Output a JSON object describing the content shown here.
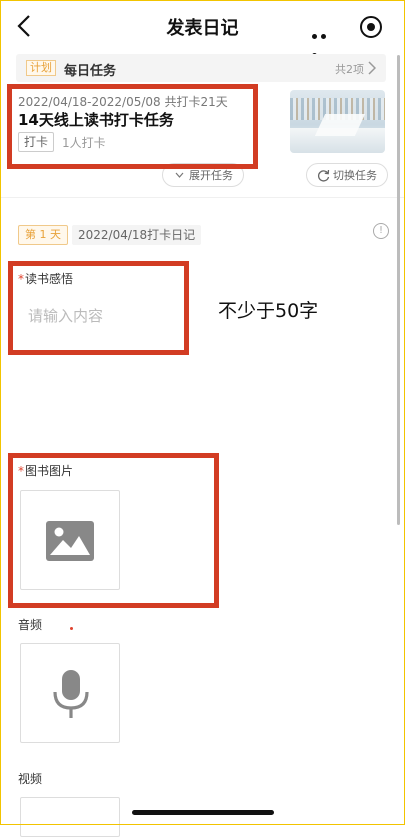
{
  "nav": {
    "title": "发表日记"
  },
  "task_header": {
    "tag": "计划",
    "title": "每日任务",
    "count": "共2项"
  },
  "task": {
    "date_range": "2022/04/18-2022/05/08 共打卡21天",
    "title": "14天线上读书打卡任务",
    "checkin_button": "打卡",
    "checkin_count": "1人打卡"
  },
  "actions": {
    "expand": "展开任务",
    "switch": "切换任务"
  },
  "day": {
    "tag": "第 1 天",
    "date": "2022/04/18打卡日记"
  },
  "form": {
    "required_mark": "*",
    "reading_label": "读书感悟",
    "reading_placeholder": "请输入内容",
    "annotation": "不少于50字",
    "images_label": "图书图片",
    "audio_label": "音频",
    "video_label": "视频"
  },
  "colors": {
    "accent": "#e8a23a",
    "highlight_box": "#d23c23",
    "required": "#e0432f"
  },
  "icons": {
    "back": "chevron-left-icon",
    "more": "more-dots-icon",
    "close": "target-circle-icon",
    "chev": "chevron-right-icon",
    "expand": "chevron-down-icon",
    "switch": "refresh-icon",
    "info": "info-icon",
    "image": "image-icon",
    "mic": "microphone-icon"
  }
}
